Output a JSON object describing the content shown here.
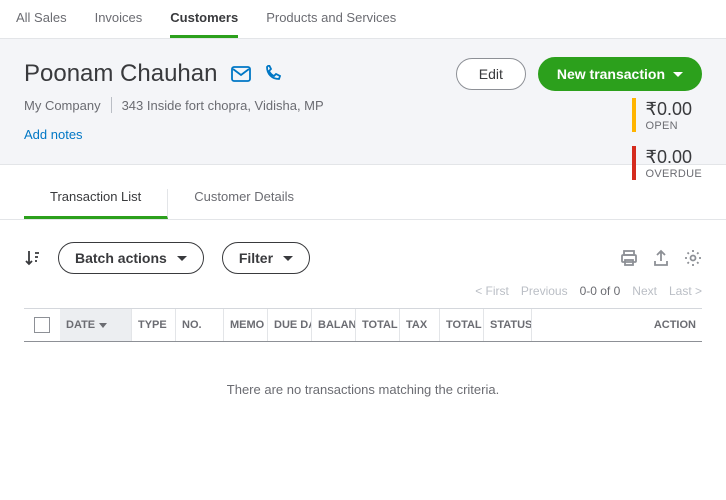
{
  "topTabs": {
    "allSales": "All Sales",
    "invoices": "Invoices",
    "customers": "Customers",
    "products": "Products and Services"
  },
  "customer": {
    "name": "Poonam Chauhan",
    "company": "My Company",
    "address": "343 Inside fort chopra, Vidisha, MP"
  },
  "addNotes": "Add notes",
  "buttons": {
    "edit": "Edit",
    "newTransaction": "New transaction"
  },
  "balances": {
    "openAmount": "₹0.00",
    "openLabel": "OPEN",
    "overdueAmount": "₹0.00",
    "overdueLabel": "OVERDUE"
  },
  "subTabs": {
    "transactionList": "Transaction List",
    "customerDetails": "Customer Details"
  },
  "toolbar": {
    "batchActions": "Batch actions",
    "filter": "Filter"
  },
  "pager": {
    "first": "< First",
    "previous": "Previous",
    "range": "0-0 of 0",
    "next": "Next",
    "last": "Last >"
  },
  "columns": {
    "date": "DATE",
    "type": "TYPE",
    "no": "NO.",
    "memo": "MEMO",
    "dueDate": "DUE DATE",
    "balance": "BALANCE",
    "total": "TOTAL",
    "tax": "TAX",
    "total2": "TOTAL",
    "status": "STATUS",
    "action": "ACTION"
  },
  "empty": "There are no transactions matching the criteria."
}
